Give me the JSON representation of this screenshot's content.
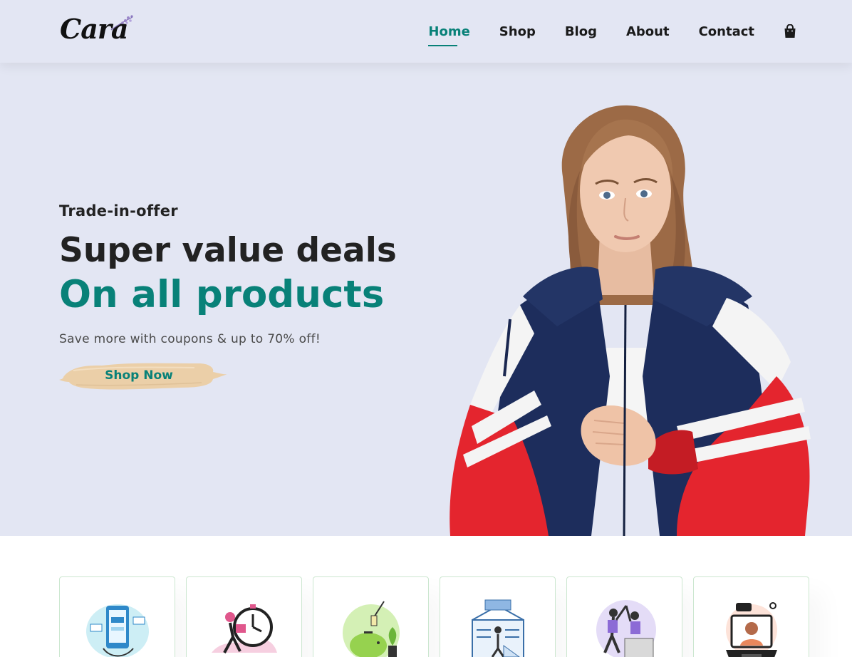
{
  "header": {
    "logo_text": "Cara",
    "nav": [
      {
        "label": "Home",
        "active": true
      },
      {
        "label": "Shop",
        "active": false
      },
      {
        "label": "Blog",
        "active": false
      },
      {
        "label": "About",
        "active": false
      },
      {
        "label": "Contact",
        "active": false
      }
    ],
    "cart_icon": "shopping-bag-icon"
  },
  "hero": {
    "kicker": "Trade-in-offer",
    "title_line1": "Super value deals",
    "title_line2": "On all products",
    "subtitle": "Save more with coupons & up to 70% off!",
    "cta_label": "Shop Now",
    "image": "model-in-track-jacket"
  },
  "features": [
    {
      "icon": "mobile-payment-illustration"
    },
    {
      "icon": "fast-delivery-illustration"
    },
    {
      "icon": "savings-piggy-bank-illustration"
    },
    {
      "icon": "promotions-illustration"
    },
    {
      "icon": "happy-sell-illustration"
    },
    {
      "icon": "online-support-illustration"
    }
  ],
  "colors": {
    "accent": "#088178",
    "hero_bg": "#e3e6f3",
    "button_brush": "#ebcfa8",
    "text_dark": "#222222",
    "feature_border": "#cce7d0"
  }
}
